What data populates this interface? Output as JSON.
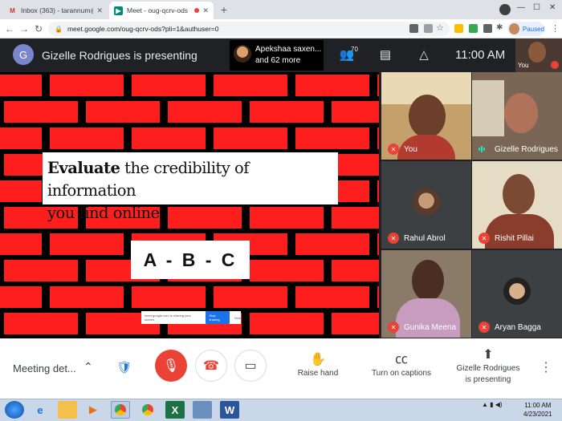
{
  "browser": {
    "tabs": [
      {
        "label": "Inbox (363) - tarannum@theindi",
        "icon": "gmail-icon",
        "active": false
      },
      {
        "label": "Meet - oug-qcrv-ods",
        "icon": "meet-icon",
        "active": true
      }
    ],
    "new_tab": "+",
    "url": "meet.google.com/oug-qcrv-ods?pli=1&authuser=0",
    "profile_status": "Paused"
  },
  "meet": {
    "presenter_initial": "G",
    "presenter_banner": "Gizelle Rodrigues is presenting",
    "raised_participant": "Apekshaa saxen...",
    "others_count": "and 62 more",
    "participant_count": "70",
    "clock": "11:00 AM",
    "self_label": "You"
  },
  "slide": {
    "bold_word": "Evaluate",
    "line1_rest": " the credibility of information",
    "line2": "you find online",
    "abc": "A - B - C",
    "share_notice": "meet.google.com is sharing your screen.",
    "stop_sharing": "Stop sharing",
    "hide": "Hide"
  },
  "participants": [
    {
      "name": "You",
      "muted": true
    },
    {
      "name": "Gizelle Rodrigues",
      "muted": false
    },
    {
      "name": "Rahul Abrol",
      "muted": true
    },
    {
      "name": "Rishit Pillai",
      "muted": true
    },
    {
      "name": "Gunika Meena",
      "muted": true
    },
    {
      "name": "Aryan Bagga",
      "muted": true
    }
  ],
  "controls": {
    "meeting_details": "Meeting det...",
    "raise_hand": "Raise hand",
    "captions": "Turn on captions",
    "presenting_line1": "Gizelle Rodrigues",
    "presenting_line2": "is presenting"
  },
  "taskbar": {
    "time": "11:00 AM",
    "date": "4/23/2021"
  },
  "colors": {
    "brick_red": "#fe1e1e",
    "meet_dark": "#202124",
    "hangup_red": "#ea4335",
    "accent_blue": "#1a73e8"
  }
}
